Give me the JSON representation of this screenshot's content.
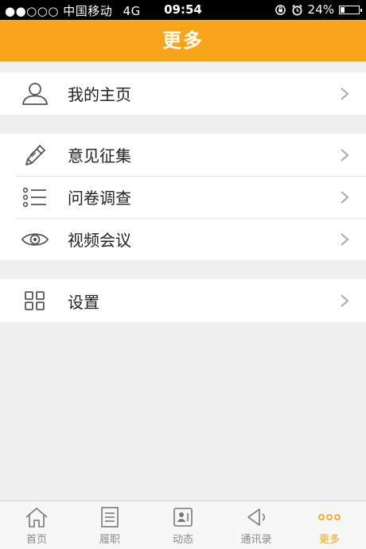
{
  "status": {
    "signal": "●●○○○",
    "carrier": "中国移动",
    "network": "4G",
    "time": "09:54",
    "battery_text": "24%",
    "battery_level": 0.24
  },
  "nav": {
    "title": "更多"
  },
  "menu": {
    "profile": "我的主页",
    "feedback": "意见征集",
    "survey": "问卷调查",
    "video_meeting": "视频会议",
    "settings": "设置"
  },
  "tabs": [
    {
      "label": "首页",
      "icon": "home-icon"
    },
    {
      "label": "履职",
      "icon": "document-icon"
    },
    {
      "label": "动态",
      "icon": "news-icon"
    },
    {
      "label": "通讯录",
      "icon": "contacts-icon"
    },
    {
      "label": "更多",
      "icon": "more-dots-icon"
    }
  ],
  "colors": {
    "accent": "#f9a51c"
  }
}
